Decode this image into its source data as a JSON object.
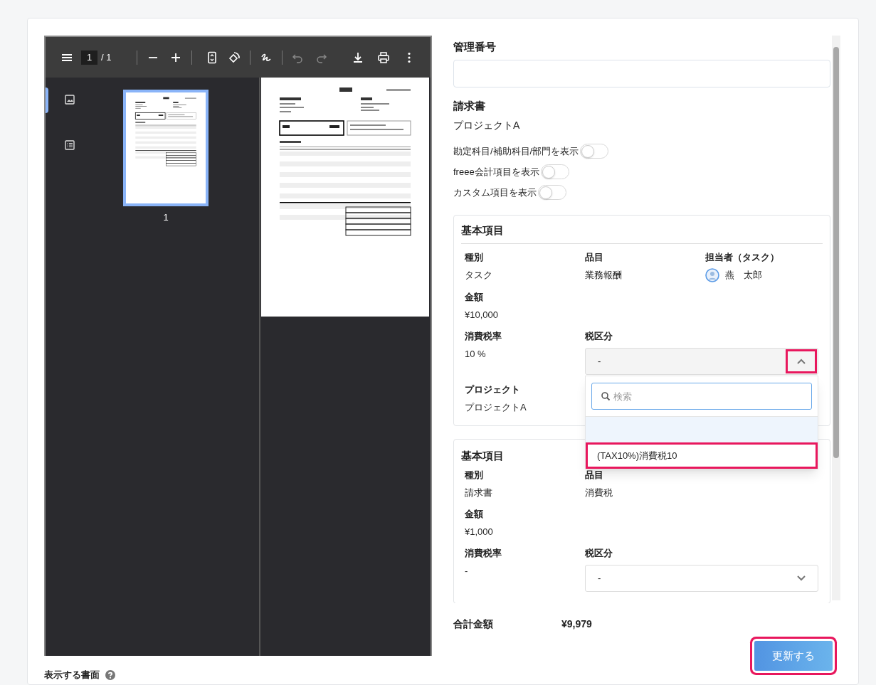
{
  "viewer": {
    "page_input": "1",
    "page_total": "/ 1",
    "sidebar_tabs": [
      {
        "kind": "thumbnails",
        "selected": true
      },
      {
        "kind": "outline",
        "selected": false
      }
    ],
    "thumbnails": [
      {
        "label": "1",
        "selected": true
      }
    ]
  },
  "display_document_label": "表示する書面",
  "form": {
    "management_number_label": "管理番号",
    "document": {
      "title": "請求書",
      "name": "プロジェクトA"
    },
    "toggles": [
      {
        "label": "勘定科目/補助科目/部門を表示",
        "on": false
      },
      {
        "label": "freee会計項目を表示",
        "on": false
      },
      {
        "label": "カスタム項目を表示",
        "on": false
      }
    ],
    "cards": [
      {
        "title": "基本項目",
        "divider": true,
        "rows": [
          [
            {
              "label": "種別",
              "value": "タスク"
            },
            {
              "label": "品目",
              "value": "業務報酬"
            },
            {
              "kind": "user",
              "label": "担当者（タスク）",
              "value": "燕　太郎"
            }
          ],
          [
            {
              "label": "金額",
              "value": "¥10,000"
            }
          ],
          [
            {
              "label": "消費税率",
              "value": "10 %"
            },
            {
              "kind": "select",
              "label": "税区分",
              "value": "-",
              "expanded": true,
              "annotated": true,
              "search_placeholder": "検索",
              "options": [
                {
                  "kind": "blank",
                  "selected": true
                },
                {
                  "kind": "item",
                  "label": "(TAX10%)消費税10",
                  "selected": false,
                  "annotated": true
                }
              ]
            }
          ],
          [
            {
              "label": "プロジェクト",
              "value": "プロジェクトA"
            }
          ]
        ]
      },
      {
        "title": "基本項目",
        "divider": false,
        "rows": [
          [
            {
              "label": "種別",
              "value": "請求書"
            },
            {
              "label": "品目",
              "value": "消費税"
            }
          ],
          [
            {
              "label": "金額",
              "value": "¥1,000"
            }
          ],
          [
            {
              "label": "消費税率",
              "value": "-"
            },
            {
              "kind": "select",
              "label": "税区分",
              "value": "-",
              "expanded": false,
              "annotated": false
            }
          ]
        ]
      }
    ],
    "total": {
      "label": "合計金額",
      "value": "¥9,979"
    },
    "submit": {
      "label": "更新する",
      "annotated": true
    }
  }
}
